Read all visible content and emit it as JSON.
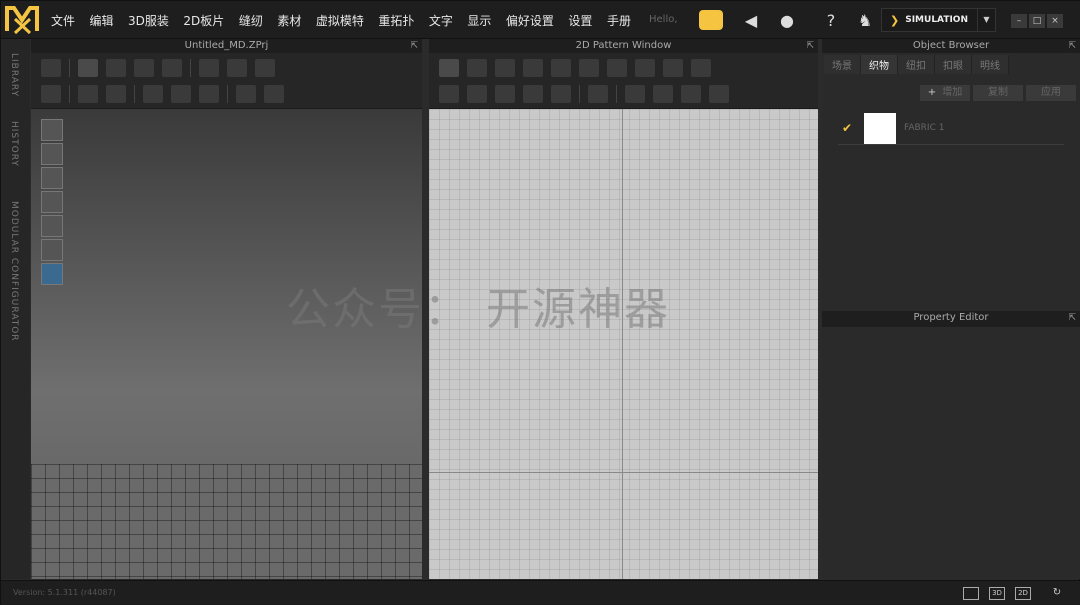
{
  "menu": [
    "文件",
    "编辑",
    "3D服装",
    "2D板片",
    "缝纫",
    "素材",
    "虚拟模特",
    "重拓扑",
    "文字",
    "显示",
    "偏好设置",
    "设置",
    "手册"
  ],
  "hello": "Hello,",
  "mode": {
    "label": "SIMULATION"
  },
  "sidetabs": [
    "LIBRARY",
    "HISTORY",
    "MODULAR CONFIGURATOR"
  ],
  "panels": {
    "p3d_title": "Untitled_MD.ZPrj",
    "p2d_title": "2D Pattern Window"
  },
  "object_browser": {
    "title": "Object Browser",
    "tabs": [
      "场景",
      "织物",
      "纽扣",
      "扣眼",
      "明线"
    ],
    "active_tab": "织物",
    "add": "增加",
    "copy": "复制",
    "apply": "应用",
    "fabrics": [
      {
        "name": "FABRIC 1",
        "checked": true
      }
    ]
  },
  "property_editor": {
    "title": "Property Editor"
  },
  "watermark": "公众号： 开源神器",
  "status": {
    "version": "Version: 5.1.311 (r44087)",
    "b3d": "3D",
    "b2d": "2D"
  },
  "colors": {
    "accent": "#f5c542"
  }
}
